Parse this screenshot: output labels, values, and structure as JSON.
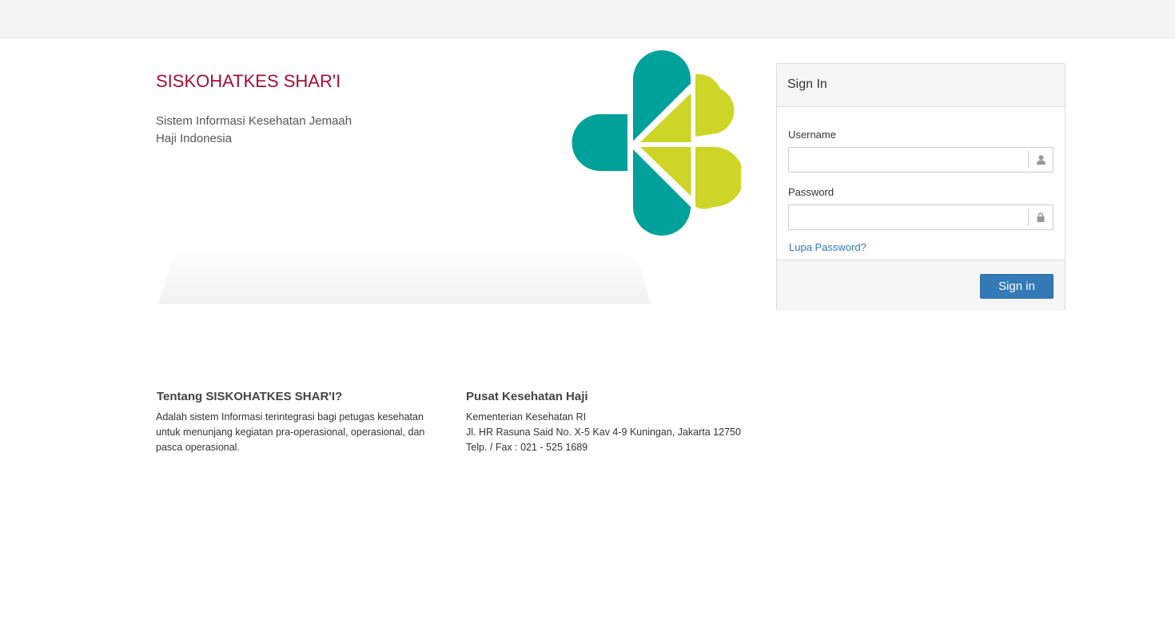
{
  "header": {
    "title": "SISKOHATKES SHAR'I",
    "subtitle": "Sistem Informasi Kesehatan Jemaah Haji Indonesia"
  },
  "login": {
    "panel_title": "Sign In",
    "username_label": "Username",
    "username_value": "",
    "username_icon": "user-icon",
    "password_label": "Password",
    "password_value": "",
    "password_icon": "lock-icon",
    "forgot_link": "Lupa Password?",
    "submit_label": "Sign in"
  },
  "info": {
    "about_title": "Tentang SISKOHATKES SHAR'I?",
    "about_text": "Adalah sistem Informasi terintegrasi bagi petugas kesehatan untuk menunjang kegiatan pra-operasional, operasional, dan pasca operasional.",
    "contact_title": "Pusat Kesehatan Haji",
    "contact_line1": "Kementerian Kesehatan RI",
    "contact_line2": "Jl. HR Rasuna Said No. X-5 Kav 4-9 Kuningan, Jakarta 12750",
    "contact_line3": "Telp. / Fax : 021 - 525 1689"
  },
  "colors": {
    "brand": "#a50d36",
    "logo_teal": "#00a19a",
    "logo_lime": "#cdd627",
    "primary_button": "#337ab7",
    "link": "#337ab7"
  }
}
